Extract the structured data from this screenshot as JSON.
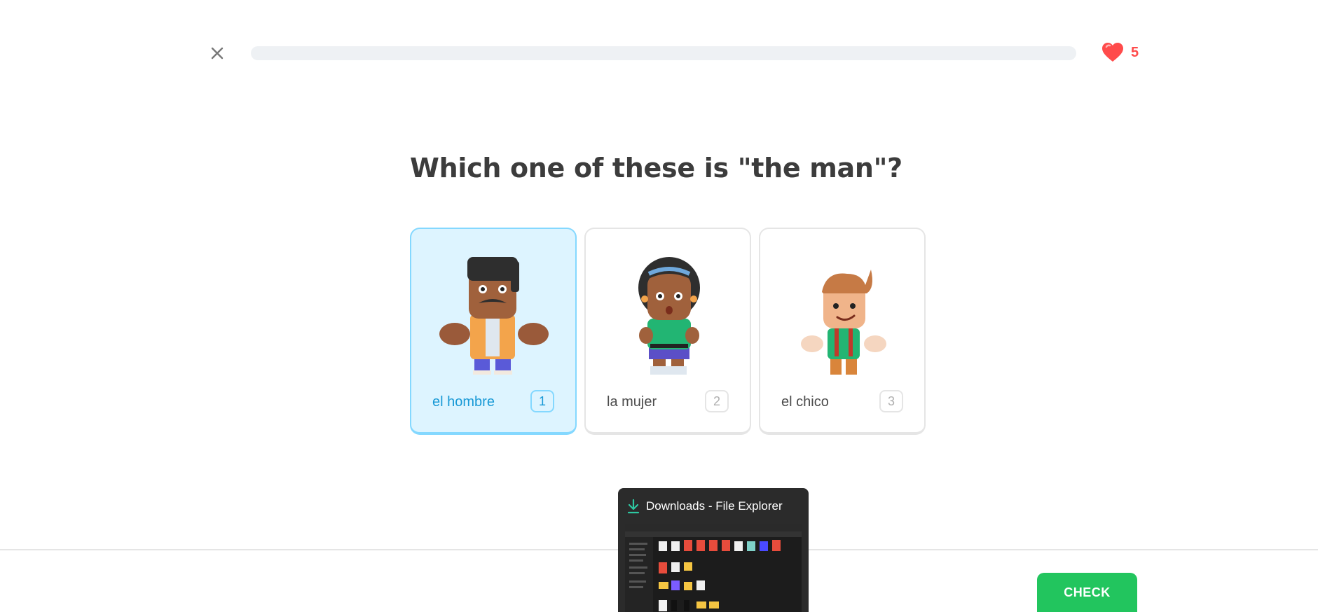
{
  "header": {
    "close_label": "Close lesson",
    "progress": 0.0,
    "hearts": "5"
  },
  "question": {
    "text": "Which one of these is \"the man\"?"
  },
  "choices": [
    {
      "label": "el hombre",
      "key": "1",
      "selected": true,
      "figure": "man-figure-icon"
    },
    {
      "label": "la mujer",
      "key": "2",
      "selected": false,
      "figure": "woman-figure-icon"
    },
    {
      "label": "el chico",
      "key": "3",
      "selected": false,
      "figure": "boy-figure-icon"
    }
  ],
  "footer": {
    "check_label": "CHECK"
  },
  "taskbar_preview": {
    "title": "Downloads - File Explorer",
    "icon": "download-icon"
  },
  "colors": {
    "accent_selected": "#1899d6",
    "selected_bg": "#ddf4ff",
    "check_green": "#22c55e",
    "heart_red": "#ff4b4b"
  }
}
